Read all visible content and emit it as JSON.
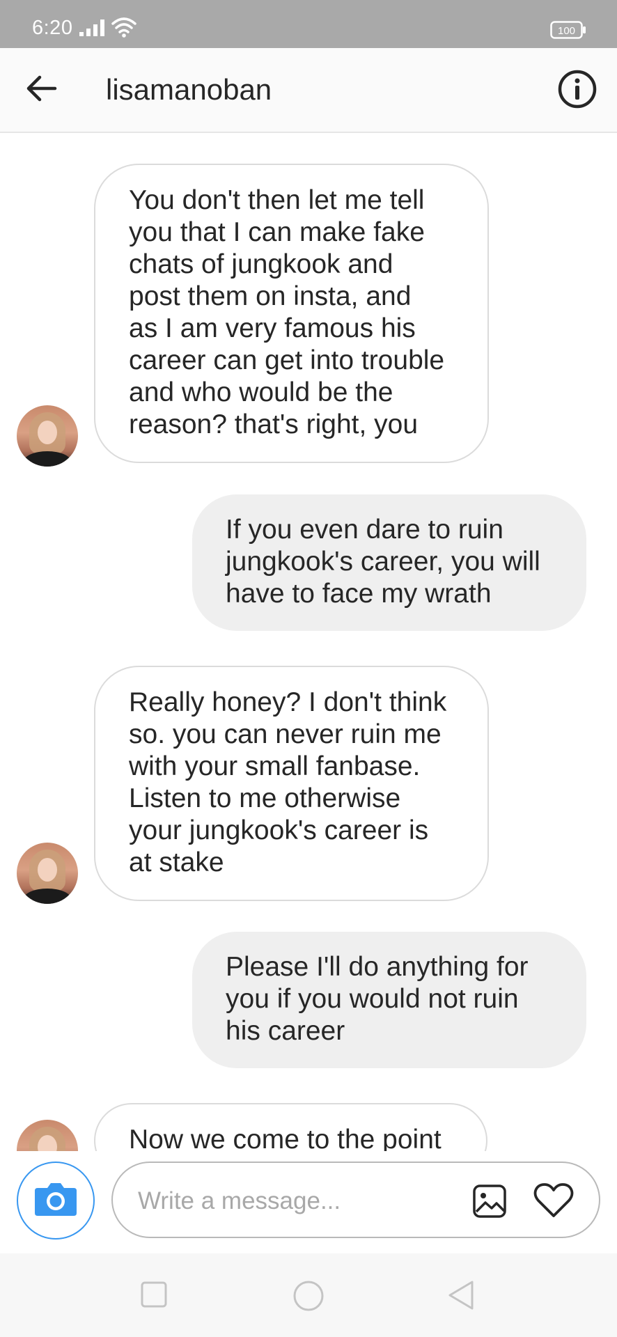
{
  "status_bar": {
    "time": "6:20",
    "battery": "100"
  },
  "header": {
    "username": "lisamanoban"
  },
  "messages": [
    {
      "side": "incoming",
      "text": "You don't then let me tell\nyou that I can make fake\nchats of jungkook and\npost them on insta, and\nas I am very famous his\ncareer can get into trouble\nand who would be the\nreason? that's right, you"
    },
    {
      "side": "outgoing",
      "text": "If you even dare to ruin\njungkook's career, you will\nhave to face my wrath"
    },
    {
      "side": "incoming",
      "text": "Really honey? I don't think\nso. you can never ruin me\nwith your small fanbase.\nListen to me otherwise\nyour jungkook's career is\nat stake"
    },
    {
      "side": "outgoing",
      "text": "Please I'll do anything for\nyou if you would not ruin\nhis career"
    },
    {
      "side": "incoming",
      "text": "Now we come to the point"
    }
  ],
  "composer": {
    "placeholder": "Write a message..."
  },
  "colors": {
    "status_bar_bg": "#a9a9a9",
    "accent_blue": "#3897f0",
    "outgoing_bubble": "#efefef",
    "incoming_border": "#dbdbdb",
    "text": "#262626"
  }
}
